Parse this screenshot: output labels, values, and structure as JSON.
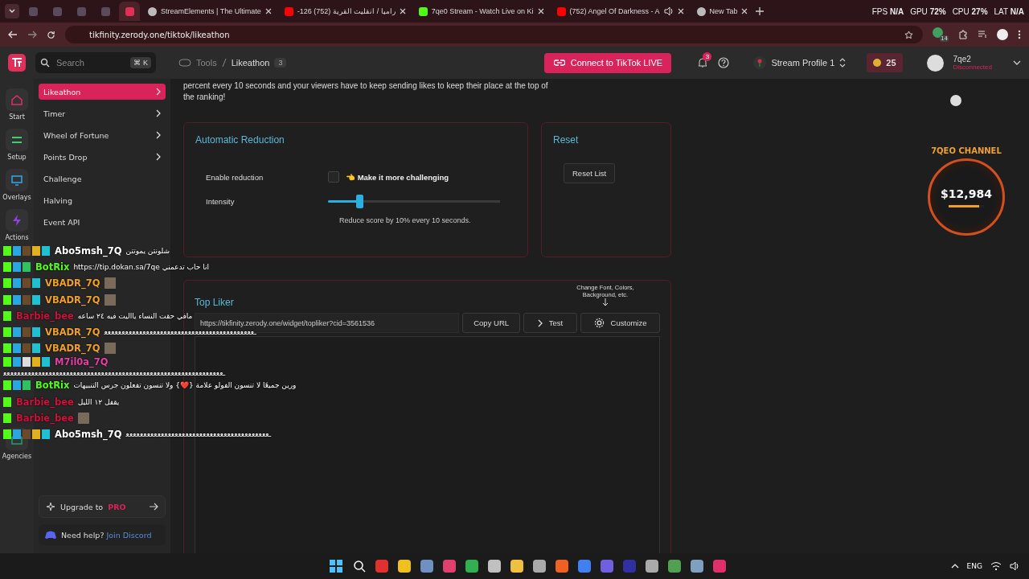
{
  "browser": {
    "tabs": [
      {
        "kind": "pinned",
        "selected": false
      },
      {
        "kind": "pinned",
        "selected": false
      },
      {
        "kind": "pinned",
        "selected": false
      },
      {
        "kind": "pinned",
        "selected": false
      },
      {
        "kind": "pinned",
        "selected": true
      },
      {
        "kind": "page",
        "title": "StreamElements | The Ultimate",
        "selected": false
      },
      {
        "kind": "video",
        "title": "-126 (752) راميا / انقليت القرية",
        "selected": false
      },
      {
        "kind": "stream",
        "title": "7qe0 Stream - Watch Live on Ki",
        "selected": false
      },
      {
        "kind": "video",
        "title": "(752) Angel Of Darkness - A",
        "selected": false,
        "audio": true
      },
      {
        "kind": "page",
        "title": "New Tab",
        "selected": false
      }
    ],
    "stats": [
      {
        "label": "FPS",
        "value": "N/A"
      },
      {
        "label": "GPU",
        "value": "72%"
      },
      {
        "label": "CPU",
        "value": "27%"
      },
      {
        "label": "LAT",
        "value": "N/A"
      }
    ],
    "url": "tikfinity.zerody.one/tiktok/likeathon",
    "extension_badge": "14"
  },
  "header": {
    "search": {
      "placeholder": "Search",
      "shortcut": "⌘ K"
    },
    "breadcrumb": [
      "Tools",
      "Likeathon"
    ],
    "breadcrumb_badge": "3",
    "connect_button": "Connect to TikTok LIVE",
    "notification_count": "3",
    "profile": "Stream Profile 1",
    "coins": "25",
    "user": {
      "name": "7qe2",
      "status": "Disconnected"
    }
  },
  "rail": [
    {
      "kind": "home",
      "label": "Start"
    },
    {
      "kind": "setup",
      "label": "Setup"
    },
    {
      "kind": "overlays",
      "label": "Overlays"
    },
    {
      "kind": "actions",
      "label": "Actions"
    },
    {
      "kind": "agencies",
      "label": "Agencies"
    }
  ],
  "submenu": [
    {
      "label": "Likeathon",
      "selected": true,
      "expandable": true
    },
    {
      "label": "Timer",
      "selected": false,
      "expandable": true
    },
    {
      "label": "Wheel of Fortune",
      "selected": false,
      "expandable": true
    },
    {
      "label": "Points Drop",
      "selected": false,
      "expandable": true
    },
    {
      "label": "Challenge",
      "selected": false,
      "expandable": false
    },
    {
      "label": "Halving",
      "selected": false,
      "expandable": false
    },
    {
      "label": "Event API",
      "selected": false,
      "expandable": false
    }
  ],
  "upgrade": {
    "text": "Upgrade to",
    "badge": "PRO"
  },
  "help": {
    "text": "Need help?",
    "link": "Join Discord"
  },
  "description": "percent every 10 seconds and your viewers have to keep sending likes to keep their place at the top of the ranking!",
  "reduction": {
    "title": "Automatic Reduction",
    "enable_label": "Enable reduction",
    "checked": false,
    "checkbox_label": "👈 Make it more challenging",
    "intensity_label": "Intensity",
    "level": 0.18,
    "hint": "Reduce score by 10% every 10 seconds."
  },
  "reset": {
    "title": "Reset",
    "button": "Reset List"
  },
  "top_liker": {
    "title": "Top Liker",
    "customize_hint": "Change Font, Colors, Background, etc.",
    "url": "https://tikfinity.zerody.one/widget/topliker?cid=3561536",
    "buttons": [
      {
        "kind": "copy",
        "label": "Copy URL"
      },
      {
        "kind": "test",
        "label": "Test"
      },
      {
        "kind": "customize",
        "label": "Customize"
      }
    ]
  },
  "goal_widget": {
    "title": "7QEO CHANNEL",
    "amount": "$12,984",
    "level": 0.86
  },
  "chat": [
    {
      "user": "Abo5msh_7Q",
      "color": "#ffffff",
      "badges": [
        {
          "kind": "kick"
        },
        {
          "kind": "mod"
        },
        {
          "kind": "bear"
        },
        {
          "kind": "crown"
        },
        {
          "kind": "og"
        }
      ],
      "text": "شلونتن يموتتن",
      "emote": false
    },
    {
      "user": "BotRix",
      "color": "#53fc18",
      "badges": [
        {
          "kind": "kick"
        },
        {
          "kind": "mod"
        },
        {
          "kind": "verified"
        }
      ],
      "text": "https://tip.dokan.sa/7qe انا حاب تدعمني",
      "emote": false
    },
    {
      "user": "VBADR_7Q",
      "color": "#f0a020",
      "badges": [
        {
          "kind": "kick"
        },
        {
          "kind": "mod"
        },
        {
          "kind": "bear"
        },
        {
          "kind": "og"
        }
      ],
      "emote": true
    },
    {
      "user": "VBADR_7Q",
      "color": "#f0a020",
      "badges": [
        {
          "kind": "kick"
        },
        {
          "kind": "mod"
        },
        {
          "kind": "bear"
        },
        {
          "kind": "og"
        }
      ],
      "emote": true
    },
    {
      "user": "Barbie_bee",
      "color": "#d0103a",
      "badges": [
        {
          "kind": "kick"
        }
      ],
      "text": "مافي حقت النساء يااليت فيه ٢٤ ساعه",
      "emote": false
    },
    {
      "user": "VBADR_7Q",
      "color": "#f0a020",
      "badges": [
        {
          "kind": "kick"
        },
        {
          "kind": "mod"
        },
        {
          "kind": "bear"
        },
        {
          "kind": "og"
        }
      ],
      "text": "ـﻌﻌﻌﻌﻌﻌﻌﻌﻌﻌﻌﻌﻌﻌﻌﻌﻌﻌﻌﻌﻌﻌﻌﻌﻌﻌﻌﻌﻌﻌﻌﻌﻌﻌﻌﻌﻌﻌﻌﻌﻌﻌﻌ",
      "emote": false
    },
    {
      "user": "VBADR_7Q",
      "color": "#f0a020",
      "badges": [
        {
          "kind": "kick"
        },
        {
          "kind": "mod"
        },
        {
          "kind": "bear"
        },
        {
          "kind": "og"
        }
      ],
      "emote": true
    },
    {
      "user": "M7il0a_7Q",
      "color": "#e040a0",
      "badges": [
        {
          "kind": "kick"
        },
        {
          "kind": "mod"
        },
        {
          "kind": "ghost"
        },
        {
          "kind": "crown"
        },
        {
          "kind": "og"
        }
      ],
      "text": "ـﻌﻌﻌﻌﻌﻌﻌﻌﻌﻌﻌﻌﻌﻌﻌﻌﻌﻌﻌﻌﻌﻌﻌﻌﻌﻌﻌﻌﻌﻌﻌﻌﻌﻌﻌﻌﻌﻌﻌﻌﻌﻌﻌﻌﻌﻌﻌﻌﻌﻌﻌﻌﻌﻌﻌﻌﻌﻌﻌﻌﻌﻌﻌ",
      "emote": false
    },
    {
      "user": "BotRix",
      "color": "#53fc18",
      "badges": [
        {
          "kind": "kick"
        },
        {
          "kind": "mod"
        },
        {
          "kind": "verified"
        }
      ],
      "text": "ورين جميعًا لا تنسون الفولو علامة {❤️} ولا تنسون تفعلون جرس التنبيهات",
      "emote": false
    },
    {
      "user": "Barbie_bee",
      "color": "#d0103a",
      "badges": [
        {
          "kind": "kick"
        }
      ],
      "text": "يقفل ١٢ الليل",
      "emote": false
    },
    {
      "user": "Barbie_bee",
      "color": "#d0103a",
      "badges": [
        {
          "kind": "kick"
        }
      ],
      "emote": true
    },
    {
      "user": "Abo5msh_7Q",
      "color": "#ffffff",
      "badges": [
        {
          "kind": "kick"
        },
        {
          "kind": "mod"
        },
        {
          "kind": "bear"
        },
        {
          "kind": "crown"
        },
        {
          "kind": "og"
        }
      ],
      "text": "ـﻌﻌﻌﻌﻌﻌﻌﻌﻌﻌﻌﻌﻌﻌﻌﻌﻌﻌﻌﻌﻌﻌﻌﻌﻌﻌﻌﻌﻌﻌﻌﻌﻌﻌﻌﻌﻌﻌﻌﻌﻌ",
      "emote": false
    }
  ],
  "taskbar": {
    "language": "ENG"
  }
}
